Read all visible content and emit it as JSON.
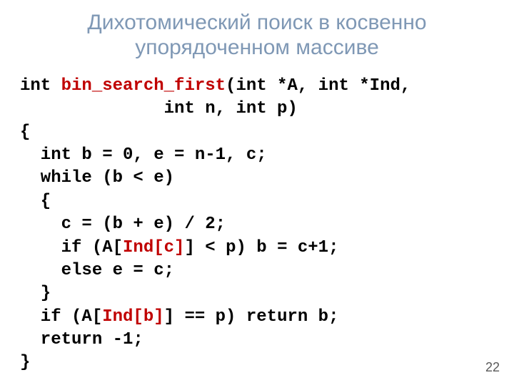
{
  "title_line1": "Дихотомический поиск в косвенно",
  "title_line2": "упорядоченном массиве",
  "code": {
    "l1a": "int ",
    "l1fn": "bin_search_first",
    "l1b": "(int *A, int *Ind,",
    "l2": "              int n, int p)",
    "l3": "{",
    "l4": "  int b = 0, e = n-1, c;",
    "l5": "  while (b < e)",
    "l6": "  {",
    "l7": "    c = (b + e) / 2;",
    "l8a": "    if (A[",
    "l8idx": "Ind[c]",
    "l8b": "] < p) b = c+1;",
    "l9": "    else e = c;",
    "l10": "  }",
    "l11a": "  if (A[",
    "l11idx": "Ind[b]",
    "l11b": "] == p) return b;",
    "l12": "  return -1;",
    "l13": "}"
  },
  "page_number": "22"
}
